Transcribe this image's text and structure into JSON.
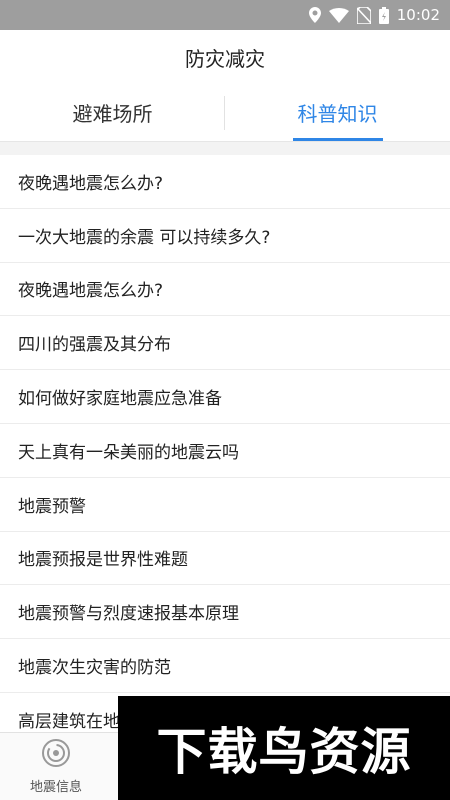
{
  "status_bar": {
    "time": "10:02",
    "icons": [
      "location-icon",
      "wifi-icon",
      "no-sim-icon",
      "battery-icon"
    ]
  },
  "header": {
    "title": "防灾减灾"
  },
  "tabs": [
    {
      "label": "避难场所",
      "active": false
    },
    {
      "label": "科普知识",
      "active": true
    }
  ],
  "articles": [
    "夜晚遇地震怎么办?",
    "一次大地震的余震 可以持续多久?",
    "夜晚遇地震怎么办?",
    "四川的强震及其分布",
    "如何做好家庭地震应急准备",
    "天上真有一朵美丽的地震云吗",
    "地震预警",
    "地震预报是世界性难题",
    "地震预警与烈度速报基本原理",
    "地震次生灾害的防范",
    "高层建筑在地"
  ],
  "bottom_nav": {
    "items": [
      {
        "label": "地震信息",
        "icon": "seismic-icon"
      }
    ]
  },
  "watermark": {
    "text": "下载鸟资源"
  },
  "colors": {
    "accent": "#2f86e6",
    "status_bar": "#9e9e9e"
  }
}
